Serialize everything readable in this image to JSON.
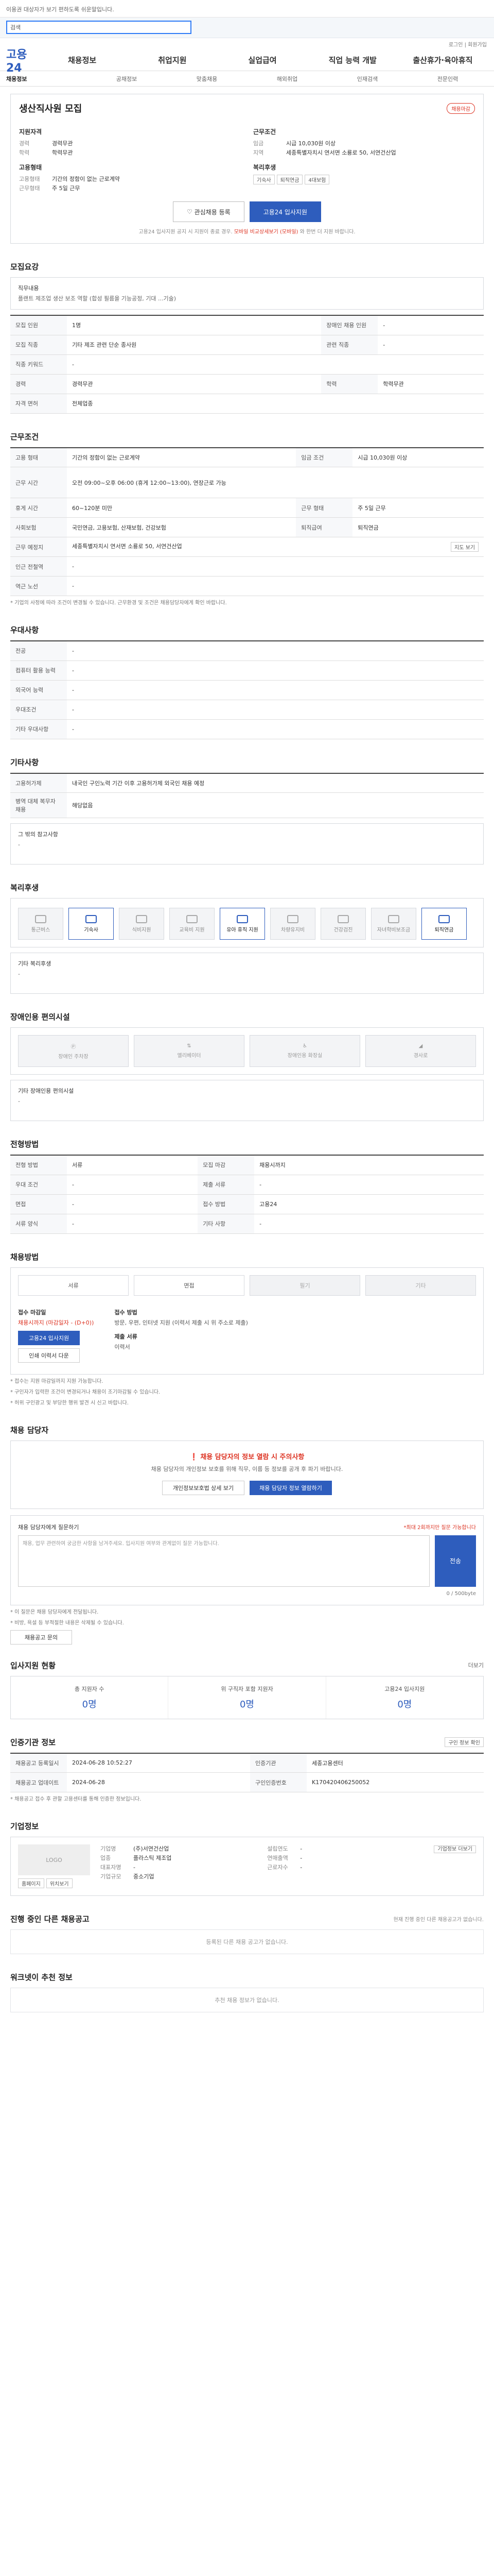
{
  "top_note": "이용권 대상자가 보기 편하도록 쉬운말입니다.",
  "search": {
    "value": "검색"
  },
  "login_links": "로그인 | 회원가입",
  "logo": "고용24",
  "nav": [
    "채용정보",
    "취업지원",
    "실업급여",
    "직업 능력 개발",
    "출산휴가·육아휴직"
  ],
  "subnav": [
    "채용정보",
    "공채정보",
    "맞춤채용",
    "해외취업",
    "인재검색",
    "전문인력"
  ],
  "job": {
    "title": "생산직사원 모집",
    "badge": "채용마감",
    "left_title": "지원자격",
    "left_rows": [
      [
        "경력",
        "경력무관"
      ],
      [
        "학력",
        "학력무관"
      ]
    ],
    "cond_title": "고용형태",
    "cond_rows": [
      [
        "고용형태",
        "기간의 정함이 없는 근로계약"
      ],
      [
        "근무형태",
        "주 5일 근무"
      ]
    ],
    "right_title": "근무조건",
    "right_rows": [
      [
        "임금",
        "시급 10,030원 이상"
      ],
      [
        "지역",
        "세종특별자치시 연서면 소룡로 50, 서연건산업"
      ]
    ],
    "wel_title": "복리후생",
    "tags": [
      "기숙사",
      "퇴직연금",
      "4대보험"
    ],
    "btn_interest": "관심채용 등록",
    "btn_apply": "고용24 입사지원",
    "note_pre": "고용24 입사지원 공지 시 지원이 종료 경우.",
    "note_red": "모바일 비교상세보기 (모바일)",
    "note_post": "와 한번 더 지원 바랍니다."
  },
  "recruit": {
    "title": "모집요강",
    "desc_label": "직무내용",
    "desc": "플랜트 제조업 생산 보조 역할 (합성 필름을 기능공정, 기대 ...기술)",
    "rows": [
      [
        "모집 인원",
        "1명",
        "장애인 채용 인원",
        "-"
      ],
      [
        "모집 직종",
        "기타 제조 관련 단순 종사원",
        "관련 직종",
        "-"
      ],
      [
        "직종 키워드",
        "-",
        "",
        ""
      ],
      [
        "경력",
        "경력무관",
        "학력",
        "학력무관"
      ],
      [
        "자격 면허",
        "전체업종",
        "",
        ""
      ]
    ]
  },
  "cond": {
    "title": "근무조건",
    "rows": [
      [
        "고용 형태",
        "기간의 정함이 없는 근로계약",
        "임금 조건",
        "시급 10,030원 이상"
      ],
      [
        "근무 시간",
        "오전 09:00~오후 06:00 (휴게 12:00~13:00), 연장근로 가능",
        "",
        ""
      ],
      [
        "휴게 시간",
        "60~120분 미만",
        "근무 형태",
        "주 5일 근무"
      ],
      [
        "사회보험",
        "국민연금, 고용보험, 산재보험, 건강보험",
        "퇴직급여",
        "퇴직연금"
      ],
      [
        "근무 예정지",
        "세종특별자치시 연서면 소룡로 50, 서연건산업",
        "",
        ""
      ],
      [
        "인근 전철역",
        "-",
        "",
        ""
      ],
      [
        "역근 노선",
        "-",
        "",
        ""
      ]
    ],
    "map_btn": "지도 보기",
    "note": "* 기업의 사정에 따라 조건이 변경될 수 있습니다. 근무환경 및 조건은 채용담당자에게 확인 바랍니다."
  },
  "pref": {
    "title": "우대사항",
    "rows": [
      [
        "전공",
        "-"
      ],
      [
        "컴퓨터 활용 능력",
        "-"
      ],
      [
        "외국어 능력",
        "-"
      ],
      [
        "우대조건",
        "-"
      ],
      [
        "기타 우대사항",
        "-"
      ]
    ]
  },
  "etc": {
    "title": "기타사항",
    "rows": [
      [
        "고용허가제",
        "내국인 구인노력 기간 이후 고용허가제 외국인 채용 예정"
      ],
      [
        "병역 대체 복무자 채용",
        "해당없음"
      ]
    ],
    "other_label": "그 밖의 참고사항",
    "other_val": "-"
  },
  "welfare": {
    "title": "복리후생",
    "items": [
      [
        "통근버스",
        false
      ],
      [
        "기숙사",
        true
      ],
      [
        "식비지원",
        false
      ],
      [
        "교육비 지원",
        false
      ],
      [
        "유아 휴직 지원",
        true
      ],
      [
        "차량유지비",
        false
      ],
      [
        "건강검진",
        false
      ],
      [
        "자녀학비보조금",
        false
      ],
      [
        "퇴직연금",
        true
      ]
    ],
    "other_label": "기타 복리후생",
    "other_val": "-"
  },
  "facility": {
    "title": "장애인용 편의시설",
    "items": [
      "장애인 주차장",
      "엘리베이터",
      "장애인용 화장실",
      "경사로"
    ],
    "other_label": "기타 장애인용 편의시설",
    "other_val": "-"
  },
  "proc": {
    "title": "전형방법",
    "rows": [
      [
        "전형 방법",
        "서류"
      ],
      [
        "모집 마감",
        "채용시까지"
      ],
      [
        "우대 조건",
        "-"
      ],
      [
        "제출 서류",
        "-"
      ],
      [
        "면접",
        "-"
      ],
      [
        "접수 방법",
        "고용24"
      ]
    ],
    "rows2": [
      [
        "서류 양식",
        "-"
      ],
      [
        "기타 사항",
        "-"
      ]
    ]
  },
  "apply": {
    "title": "채용방법",
    "items": [
      [
        "서류",
        false
      ],
      [
        "면접",
        false
      ],
      [
        "필기",
        true
      ],
      [
        "기타",
        true
      ]
    ],
    "period_label": "접수 마감일",
    "period_val": "채용시까지 (마감일자 - (D+0))",
    "btn_apply": "고용24 입사지원",
    "btn_print": "인쇄 이력서 다운",
    "method_label": "접수 방법",
    "method_val": "방문, 우편, 인터넷 지원 (이력서 제출 시 위 주소로 제출)",
    "form_label": "제출 서류",
    "form_val": "이력서",
    "notes": [
      "* 접수는 지원 마감일까지 지원 가능합니다.",
      "* 구인자가 입력한 조건이 변경되거나 채용이 조기마감될 수 있습니다.",
      "* 허위 구인광고 및 부당한 행위 발견 시 신고 바랍니다."
    ]
  },
  "contact": {
    "title": "채용 담당자",
    "warn": "채용 담당자의 정보 열람 시 주의사항",
    "text": "채용 담당자의 개인정보 보호를 위해 직무, 이름 등 정보를 공개 후 파기 바랍니다.",
    "btn_show": "개인정보보호법 상세 보기",
    "btn_reveal": "채용 담당자 정보 열람하기"
  },
  "inquiry": {
    "label": "채용 담당자에게 질문하기",
    "limit": "*최대 2회까지만 질문 가능합니다",
    "placeholder": "채용, 업무 관련하여 궁금한 사항을 남겨주세요. 입사지원 여부와 관계없이 질문 가능합니다.",
    "count": "0 / 500byte",
    "send": "전송",
    "notes": [
      "* 이 질문은 채용 담당자에게 전달됩니다.",
      "* 비방, 욕설 등 부적절한 내용은 삭제될 수 있습니다."
    ],
    "mail_btn": "채용공고 문의"
  },
  "status": {
    "title": "입사지원 현황",
    "more": "더보기",
    "stats": [
      [
        "총 지원자 수",
        "0명"
      ],
      [
        "위 구직자 포함 지원자",
        "0명"
      ],
      [
        "고용24 입사지원",
        "0명"
      ]
    ]
  },
  "info": {
    "title": "인증기관 정보",
    "btn": "구인 정보 확인",
    "rows": [
      [
        "채용공고 등록일시",
        "2024-06-28 10:52:27",
        "인증기관",
        "세종고용센터"
      ],
      [
        "채용공고 업데이트",
        "2024-06-28",
        "구인인증번호",
        "K170420406250052"
      ]
    ],
    "note": "* 채용공고 접수 후 관할 고용센터를 통해 인증한 정보입니다."
  },
  "company": {
    "title": "기업정보",
    "logo": "LOGO",
    "btn_home": "홈페이지",
    "btn_map": "위치보기",
    "rows": [
      [
        "기업명",
        "(주)서연건산업"
      ],
      [
        "업종",
        "플라스틱 제조업"
      ],
      [
        "대표자명",
        "-"
      ],
      [
        "기업규모",
        "중소기업"
      ]
    ],
    "rows2": [
      [
        "설립연도",
        "-"
      ],
      [
        "연매출액",
        "-"
      ],
      [
        "근로자수",
        "-"
      ]
    ],
    "btn_more": "기업정보 더보기"
  },
  "other": {
    "title": "진행 중인 다른 채용공고",
    "sub": "현재 진행 중인 다른 채용공고가 없습니다.",
    "empty": "등록된 다른 채용 공고가 없습니다."
  },
  "recommend": {
    "title": "워크넷이 추천 정보",
    "empty": "추천 채용 정보가 없습니다."
  }
}
